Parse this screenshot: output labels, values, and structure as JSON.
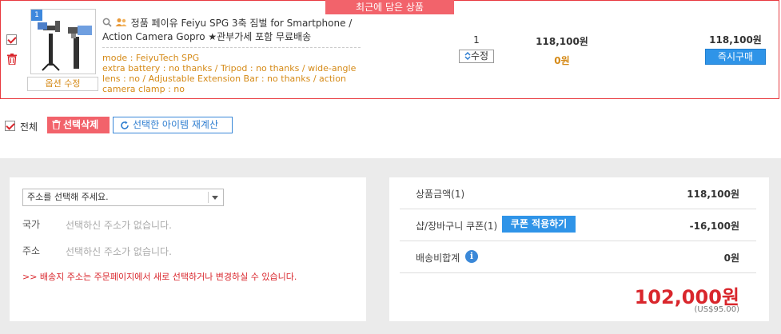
{
  "cart_item": {
    "recent_tag": "최근에 담은 상품",
    "image_index": "1",
    "option_edit_label": "옵션 수정",
    "title": "정품 페이유 Feiyu SPG 3축 짐벌 for Smartphone / Action Camera Gopro ★관부가세 포함 무료배송",
    "options": [
      "mode : FeiyuTech SPG",
      "extra battery : no thanks / Tripod : no thanks / wide-angle",
      "lens : no / Adjustable Extension Bar : no thanks / action",
      "camera clamp : no"
    ],
    "quantity": "1",
    "qty_edit_label": "수정",
    "price": "118,100원",
    "discount": "0원",
    "total": "118,100원",
    "buy_now_label": "즉시구매"
  },
  "controls": {
    "select_all_label": "전체",
    "delete_selected_label": "선택삭제",
    "recalculate_label": "선택한 아이템 재계산"
  },
  "address": {
    "select_placeholder": "주소를 선택해 주세요.",
    "country_label": "국가",
    "country_value": "선택하신 주소가 없습니다.",
    "address_label": "주소",
    "address_value": "선택하신 주소가 없습니다.",
    "notice": ">> 배송지 주소는 주문페이지에서 새로 선택하거나 변경하실 수 있습니다."
  },
  "summary": {
    "product_amount_label": "상품금액(1)",
    "product_amount_value": "118,100원",
    "coupon_label": "샵/장바구니 쿠폰(1)",
    "coupon_button_label": "쿠폰 적용하기",
    "coupon_value": "-16,100원",
    "shipping_label": "배송비합계",
    "shipping_value": "0원",
    "grand_total": "102,000원",
    "grand_total_usd": "(US$95.00)"
  },
  "colors": {
    "accent_red": "#e8393f",
    "tag_pink": "#f2636b",
    "primary_blue": "#2f94e8",
    "option_orange": "#d58a17"
  }
}
